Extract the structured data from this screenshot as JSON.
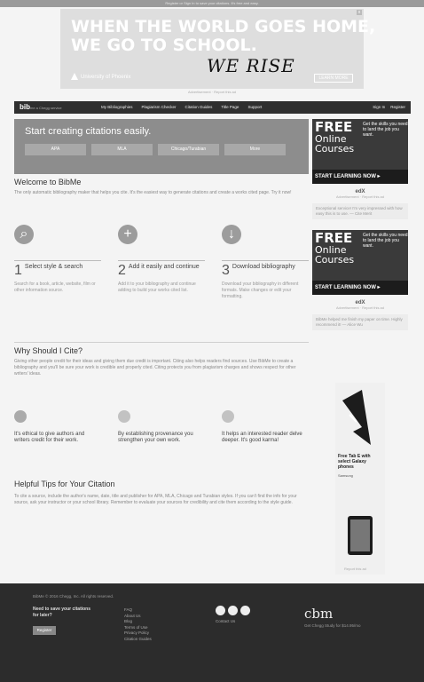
{
  "topbar": {
    "notice": "Register or Sign In to save your citations. It's free and easy."
  },
  "ad_top": {
    "headline_1": "WHEN THE WORLD GOES HOME,",
    "headline_2": "WE GO TO SCHOOL.",
    "tagline": "WE RISE",
    "sponsor": "University of Phoenix",
    "cta": "LEARN MORE",
    "close": "x"
  },
  "ad_note": "Advertisement · Report this ad",
  "nav": {
    "logo": "bib",
    "logo_small": "me  a Chegg service",
    "links": [
      "My Bibliographies",
      "Plagiarism Checker",
      "Citation Guides",
      "Title Page",
      "Support"
    ],
    "sign_in": "Sign In",
    "register": "Register"
  },
  "hero": {
    "title": "Start creating citations easily.",
    "buttons": [
      "APA",
      "MLA",
      "Chicago/Turabian",
      "More"
    ]
  },
  "welcome": {
    "title": "Welcome to BibMe",
    "text": "The only automatic bibliography maker that helps you cite. It's the easiest way to generate citations and create a works cited page. Try it now!"
  },
  "steps": [
    {
      "num": "1",
      "icon": "search-icon",
      "glyph": "⌕",
      "label": "Select style & search",
      "desc": "Search for a book, article, website, film or other information source."
    },
    {
      "num": "2",
      "icon": "plus-icon",
      "glyph": "+",
      "label": "Add it easily and continue",
      "desc": "Add it to your bibliography and continue adding to build your works cited list."
    },
    {
      "num": "3",
      "icon": "download-icon",
      "glyph": "↓",
      "label": "Download bibliography",
      "desc": "Download your bibliography in different formats. Make changes or edit your formatting."
    }
  ],
  "why": {
    "title": "Why Should I Cite?",
    "text": "Giving other people credit for their ideas and giving them due credit is important. Citing also helps readers find sources. Use BibMe to create a bibliography and you'll be sure your work is credible and properly cited. Citing protects you from plagiarism charges and shows respect for other writers' ideas."
  },
  "why_items": [
    {
      "icon": "globe-icon",
      "text": "It's ethical to give authors and writers credit for their work."
    },
    {
      "icon": "check-icon",
      "text": "By establishing provenance you strengthen your own work."
    },
    {
      "icon": "heart-icon",
      "text": "It helps an interested reader delve deeper. It's good karma!"
    }
  ],
  "tips": {
    "title": "Helpful Tips for Your Citation",
    "text": "To cite a source, include the author's name, date, title and publisher for APA, MLA, Chicago and Turabian styles. If you can't find the info for your source, ask your instructor or your school library. Remember to evaluate your sources for credibility and cite them according to the style guide."
  },
  "sidebar": {
    "free_ad": {
      "free": "FREE",
      "online": "Online",
      "courses": "Courses",
      "side_text": "Get the skills you need to land the job you want.",
      "cta": "START LEARNING NOW ▸"
    },
    "edx": "edX",
    "edx_sub": "Advertisement · Report this ad",
    "quote_1": "Exceptional service! I'm very impressed with how easy this is to use. — Cite Merit",
    "quote_2": "BibMe helped me finish my paper on time. Highly recommend it! — Alice Wu"
  },
  "phone_ad": {
    "title": "Free Tab E with select Galaxy phones",
    "sub": "Samsung",
    "note": "Report this ad"
  },
  "footer": {
    "copyright": "BibMe © 2016 Chegg, Inc. All rights reserved.",
    "need": "Need to save your citations for later?",
    "register": "Register",
    "links": [
      "FAQ",
      "About Us",
      "Blog",
      "Terms of Use",
      "Privacy Policy",
      "Citation Guides"
    ],
    "contact": "Contact Us",
    "chegg": "cbm",
    "chegg_sub": "Get Chegg Study for $14.95/mo"
  },
  "colors": {
    "accent": "#3a3a3a",
    "hero_bg": "#8d8d8d",
    "footer_bg": "#2c2c2c"
  }
}
